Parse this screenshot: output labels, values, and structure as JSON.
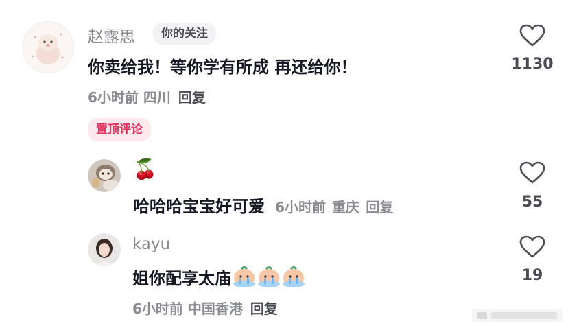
{
  "comments": [
    {
      "username": "赵露思",
      "tag": "你的关注",
      "text": "你卖给我！等你学有所成 再还给你！",
      "time": "6小时前",
      "location": "四川",
      "reply_label": "回复",
      "pinned_label": "置顶评论",
      "likes": "1130"
    },
    {
      "username": "",
      "emoji": "🍒",
      "text": "哈哈哈宝宝好可爱",
      "time": "6小时前",
      "location": "重庆",
      "reply_label": "回复",
      "likes": "55"
    },
    {
      "username": "kayu",
      "text": "姐你配享太庙",
      "time": "6小时前",
      "location": "中国香港",
      "reply_label": "回复",
      "likes": "19"
    }
  ],
  "icons": {
    "like": "heart-outline-icon",
    "sticker": "crying-face-sticker"
  },
  "colors": {
    "pin_text": "#e3335c",
    "pin_bg": "#fde9ee",
    "meta": "#8a8b91"
  }
}
